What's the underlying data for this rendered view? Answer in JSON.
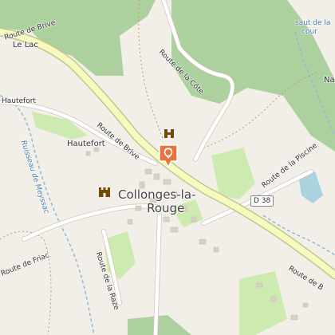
{
  "map": {
    "places": {
      "town_line1": "Collonges-la-",
      "town_line2": "Rouge",
      "hautefort": "Hautefort",
      "hautefort_road": "Hautefort",
      "le_lac": "Le Lac",
      "saut_line1": "saut de la",
      "saut_line2": "cour",
      "na": "Na"
    },
    "roads": {
      "route_de_brive_nw": "Route de Brive",
      "route_de_brive_center": "Route de Brive",
      "route_de_brive_se": "Route de B",
      "route_de_la_cote": "Route de la Côte",
      "route_de_la_piscine": "Route de la Piscine",
      "route_de_friac": "Route de Friac",
      "route_de_la_raze": "Route de la Raze",
      "shield_d38": "D 38"
    },
    "water": {
      "ruisseau": "Ruisseau de Meyssac"
    },
    "colors": {
      "background": "#f2efe9",
      "forest": "#add19e",
      "grass": "#cdebb0",
      "main_road": "#f7fabf",
      "main_road_casing": "#c5c58a",
      "minor_road": "#ffffff",
      "water": "#aad3df",
      "stream": "#8fb8d8",
      "marker": "#e8743b"
    },
    "icons": [
      "map-marker-icon",
      "viewpoint-icon",
      "castle-icon"
    ]
  }
}
